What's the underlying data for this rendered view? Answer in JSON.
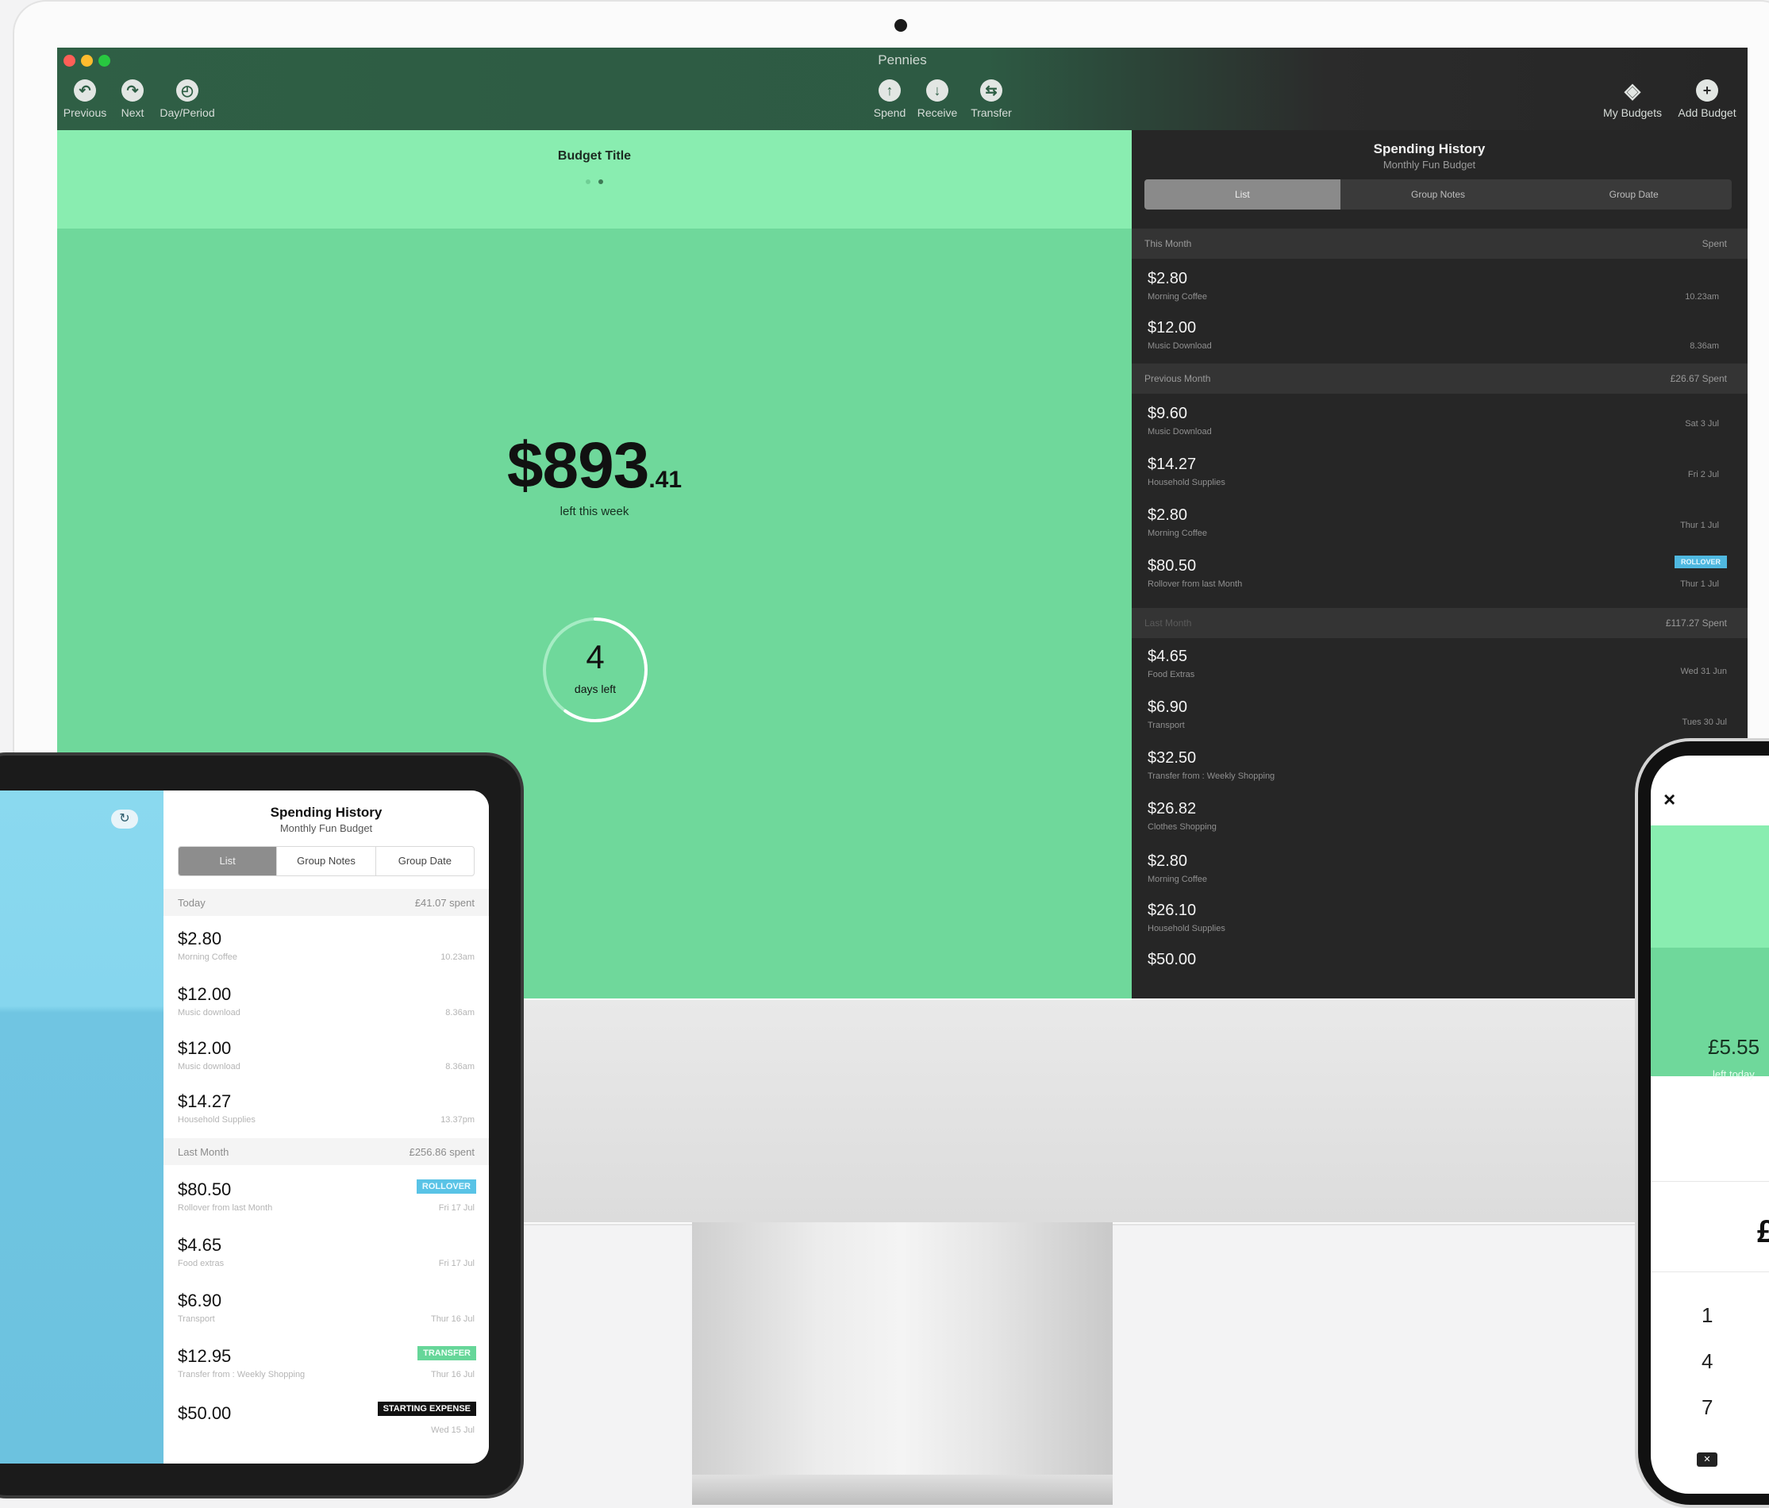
{
  "app": {
    "title": "Pennies"
  },
  "toolbar": {
    "previous": "Previous",
    "next": "Next",
    "day_period": "Day/Period",
    "spend": "Spend",
    "receive": "Receive",
    "transfer": "Transfer",
    "my_budgets": "My Budgets",
    "add_budget": "Add Budget"
  },
  "budget": {
    "title": "Budget Title",
    "amount_main": "$893",
    "amount_cents": ".41",
    "amount_label": "left this week",
    "days_number": "4",
    "days_label": "days left",
    "days_ring_fraction": 0.6
  },
  "history": {
    "title": "Spending History",
    "subtitle": "Monthly Fun Budget",
    "tabs": [
      "List",
      "Group Notes",
      "Group Date"
    ],
    "sections": [
      {
        "label": "This Month",
        "right": "Spent",
        "rows": [
          {
            "amount": "$2.80",
            "note": "Morning Coffee",
            "time": "10.23am"
          },
          {
            "amount": "$12.00",
            "note": "Music Download",
            "time": "8.36am"
          }
        ]
      },
      {
        "label": "Previous Month",
        "right": "£26.67 Spent",
        "rows": [
          {
            "amount": "$9.60",
            "note": "Music Download",
            "time": "Sat 3 Jul"
          },
          {
            "amount": "$14.27",
            "note": "Household Supplies",
            "time": "Fri 2 Jul"
          },
          {
            "amount": "$2.80",
            "note": "Morning Coffee",
            "time": "Thur 1 Jul"
          },
          {
            "amount": "$80.50",
            "note": "Rollover from last Month",
            "time": "Thur 1 Jul",
            "badge": "ROLLOVER"
          }
        ]
      },
      {
        "label": "Last Month",
        "right": "£117.27 Spent",
        "rows": [
          {
            "amount": "$4.65",
            "note": "Food Extras",
            "time": "Wed 31 Jun"
          },
          {
            "amount": "$6.90",
            "note": "Transport",
            "time": "Tues 30 Jul"
          },
          {
            "amount": "$32.50",
            "note": "Transfer from : Weekly Shopping",
            "time": ""
          },
          {
            "amount": "$26.82",
            "note": "Clothes Shopping",
            "time": ""
          },
          {
            "amount": "$2.80",
            "note": "Morning Coffee",
            "time": ""
          },
          {
            "amount": "$26.10",
            "note": "Household Supplies",
            "time": ""
          },
          {
            "amount": "$50.00",
            "note": "",
            "time": ""
          }
        ]
      }
    ]
  },
  "ipad": {
    "refresh_icon": "refresh-icon",
    "title": "Spending History",
    "subtitle": "Monthly Fun Budget",
    "tabs": [
      "List",
      "Group Notes",
      "Group Date"
    ],
    "today_label": "Today",
    "today_spent": "£41.07 spent",
    "today_rows": [
      {
        "amount": "$2.80",
        "note": "Morning Coffee",
        "time": "10.23am"
      },
      {
        "amount": "$12.00",
        "note": "Music download",
        "time": "8.36am"
      },
      {
        "amount": "$12.00",
        "note": "Music download",
        "time": "8.36am"
      },
      {
        "amount": "$14.27",
        "note": "Household Supplies",
        "time": "13.37pm"
      }
    ],
    "last_label": "Last Month",
    "last_spent": "£256.86 spent",
    "last_rows": [
      {
        "amount": "$80.50",
        "note": "Rollover from last Month",
        "time": "Fri 17 Jul",
        "badge": "ROLLOVER"
      },
      {
        "amount": "$4.65",
        "note": "Food extras",
        "time": "Fri 17 Jul"
      },
      {
        "amount": "$6.90",
        "note": "Transport",
        "time": "Thur 16 Jul"
      },
      {
        "amount": "$12.95",
        "note": "Transfer from : Weekly Shopping",
        "time": "Thur 16 Jul",
        "badge": "TRANSFER"
      },
      {
        "amount": "$50.00",
        "note": "",
        "time": "Wed 15 Jul",
        "badge": "STARTING EXPENSE"
      }
    ]
  },
  "phone": {
    "close": "×",
    "amount": "£5.55",
    "amount_label": "left today",
    "currency": "£",
    "keys": [
      "1",
      "4",
      "7"
    ]
  },
  "colors": {
    "mint_light": "#89edb0",
    "mint": "#6fd89b",
    "toolbar_green": "#2f5f45",
    "dark_panel": "#262626",
    "rollover_blue": "#4fb8e0",
    "transfer_green": "#5fd08f"
  }
}
